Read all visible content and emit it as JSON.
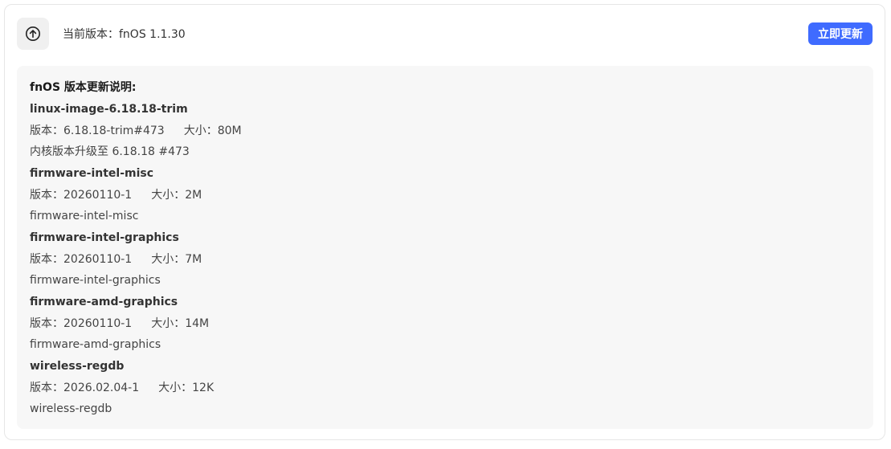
{
  "header": {
    "icon": "arrow-up-circle-icon",
    "version_text": "当前版本：fnOS 1.1.30",
    "update_button_label": "立即更新"
  },
  "notes": {
    "title": "fnOS 版本更新说明:",
    "packages": [
      {
        "name": "linux-image-6.18.18-trim",
        "version": "版本：6.18.18-trim#473",
        "size": "大小：80M",
        "description": "内核版本升级至 6.18.18 #473"
      },
      {
        "name": "firmware-intel-misc",
        "version": "版本：20260110-1",
        "size": "大小：2M",
        "description": "firmware-intel-misc"
      },
      {
        "name": "firmware-intel-graphics",
        "version": "版本：20260110-1",
        "size": "大小：7M",
        "description": "firmware-intel-graphics"
      },
      {
        "name": "firmware-amd-graphics",
        "version": "版本：20260110-1",
        "size": "大小：14M",
        "description": "firmware-amd-graphics"
      },
      {
        "name": "wireless-regdb",
        "version": "版本：2026.02.04-1",
        "size": "大小：12K",
        "description": "wireless-regdb"
      }
    ]
  },
  "colors": {
    "accent": "#3f6bff",
    "notes_background": "#f7f7f7",
    "icon_background": "#f0f0f0"
  }
}
